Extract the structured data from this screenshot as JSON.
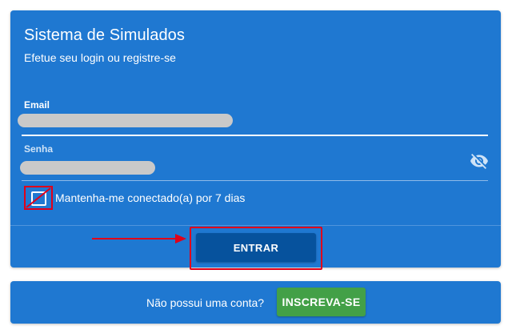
{
  "login_card": {
    "title": "Sistema de Simulados",
    "subtitle": "Efetue seu login ou registre-se",
    "email_field": {
      "label": "Email",
      "value": "",
      "value_redacted": true
    },
    "password_field": {
      "label": "Senha",
      "value": "",
      "value_redacted": true,
      "visibility_icon": "eye-off-icon"
    },
    "remember_me": {
      "label": "Mantenha-me conectado(a) por 7 dias",
      "checked": false
    },
    "submit_label": "ENTRAR"
  },
  "signup_card": {
    "question": "Não possui uma conta?",
    "button_label": "INSCREVA-SE"
  },
  "colors": {
    "card_background": "#1f78d1",
    "primary_button": "#06529d",
    "signup_button": "#43a047",
    "annotation_red": "#e0001a",
    "redaction_gray": "#c9c9c9"
  },
  "annotations": {
    "arrow_icon": "arrow-right-icon",
    "highlights": [
      "remember-me-checkbox",
      "entrar-button"
    ]
  }
}
